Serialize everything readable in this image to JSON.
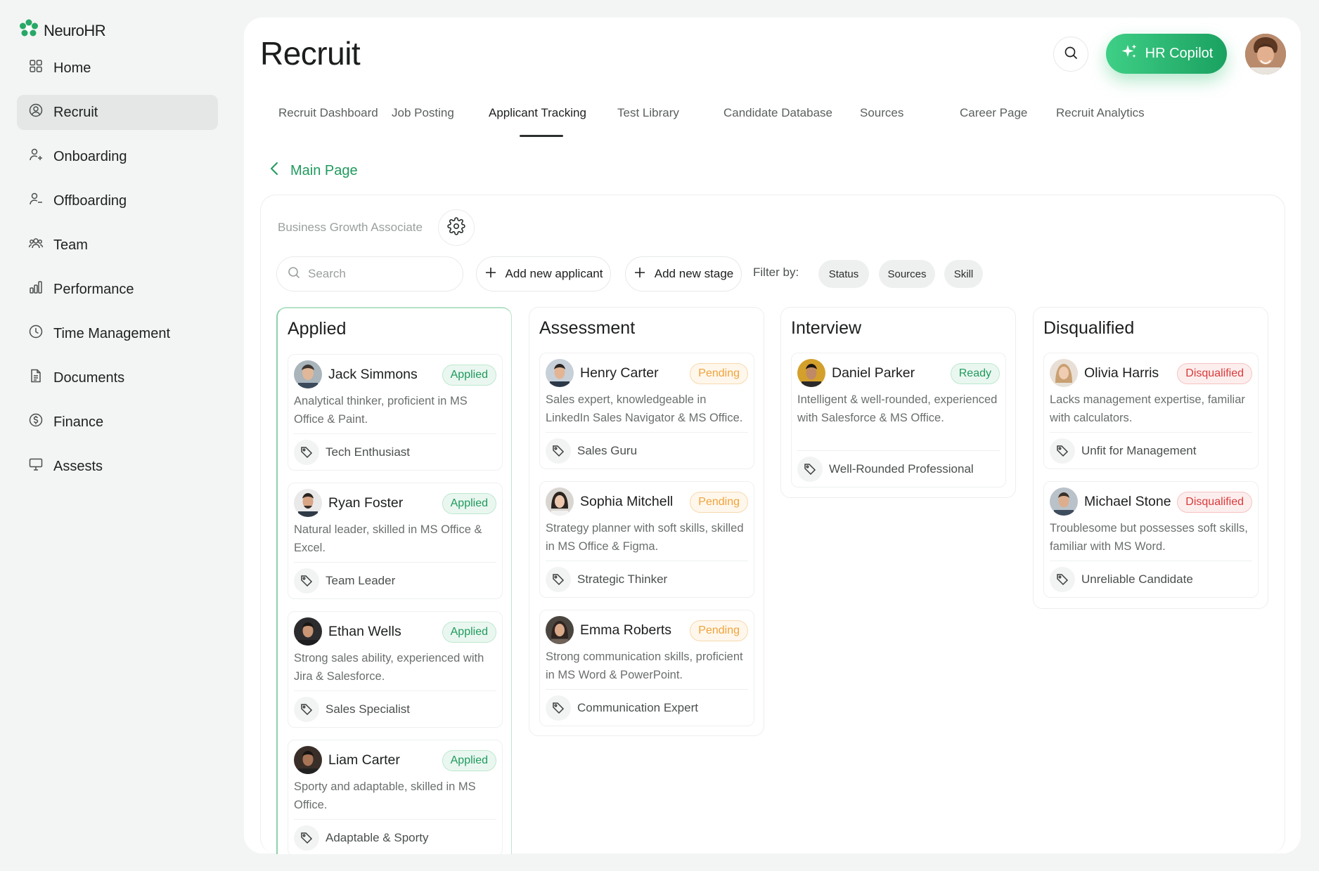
{
  "app": {
    "name": "NeuroHR"
  },
  "sidebar": {
    "items": [
      {
        "label": "Home",
        "icon": "grid-icon",
        "active": false
      },
      {
        "label": "Recruit",
        "icon": "user-circle-icon",
        "active": true
      },
      {
        "label": "Onboarding",
        "icon": "user-plus-icon",
        "active": false
      },
      {
        "label": "Offboarding",
        "icon": "user-minus-icon",
        "active": false
      },
      {
        "label": "Team",
        "icon": "users-icon",
        "active": false
      },
      {
        "label": "Performance",
        "icon": "bar-chart-icon",
        "active": false
      },
      {
        "label": "Time Management",
        "icon": "clock-icon",
        "active": false
      },
      {
        "label": "Documents",
        "icon": "document-icon",
        "active": false
      },
      {
        "label": "Finance",
        "icon": "dollar-icon",
        "active": false
      },
      {
        "label": "Assests",
        "icon": "monitor-icon",
        "active": false
      }
    ]
  },
  "header": {
    "title": "Recruit",
    "copilot_label": "HR Copilot"
  },
  "tabs": [
    {
      "label": "Recruit Dashboard",
      "active": false
    },
    {
      "label": "Job Posting",
      "active": false
    },
    {
      "label": "Applicant Tracking",
      "active": true
    },
    {
      "label": "Test Library",
      "active": false
    },
    {
      "label": "Candidate Database",
      "active": false
    },
    {
      "label": "Sources",
      "active": false
    },
    {
      "label": "Career Page",
      "active": false
    },
    {
      "label": "Recruit Analytics",
      "active": false
    }
  ],
  "back_link": "Main Page",
  "board": {
    "job_title": "Business Growth Associate",
    "search_placeholder": "Search",
    "add_applicant_label": "Add new applicant",
    "add_stage_label": "Add new stage",
    "filter_label": "Filter by:",
    "filters": [
      "Status",
      "Sources",
      "Skill"
    ]
  },
  "columns": [
    {
      "title": "Applied",
      "cards": [
        {
          "name": "Jack Simmons",
          "status": "Applied",
          "desc": "Analytical thinker, proficient in MS Office & Paint.",
          "tag": "Tech Enthusiast"
        },
        {
          "name": "Ryan Foster",
          "status": "Applied",
          "desc": "Natural leader, skilled in MS Office & Excel.",
          "tag": "Team Leader"
        },
        {
          "name": "Ethan Wells",
          "status": "Applied",
          "desc": " Strong sales ability, experienced with Jira & Salesforce.",
          "tag": "Sales Specialist"
        },
        {
          "name": "Liam Carter",
          "status": "Applied",
          "desc": "Sporty and adaptable, skilled in MS Office.",
          "tag": "Adaptable & Sporty"
        }
      ]
    },
    {
      "title": "Assessment",
      "cards": [
        {
          "name": "Henry Carter",
          "status": "Pending",
          "desc": "Sales expert, knowledgeable in LinkedIn Sales Navigator & MS Office.",
          "tag": "Sales Guru"
        },
        {
          "name": "Sophia Mitchell",
          "status": "Pending",
          "desc": "Strategy planner with soft skills, skilled in MS Office & Figma.",
          "tag": "Strategic Thinker"
        },
        {
          "name": "Emma Roberts",
          "status": "Pending",
          "desc": "Strong communication skills, proficient in MS Word & PowerPoint.",
          "tag": "Communication Expert"
        }
      ]
    },
    {
      "title": "Interview",
      "cards": [
        {
          "name": "Daniel Parker",
          "status": "Ready",
          "desc": "Intelligent & well-rounded, experienced with Salesforce & MS Office.",
          "tag": "Well-Rounded Professional"
        }
      ]
    },
    {
      "title": "Disqualified",
      "cards": [
        {
          "name": "Olivia Harris",
          "status": "Disqualified",
          "desc": "Lacks management expertise, familiar with calculators.",
          "tag": "Unfit for Management"
        },
        {
          "name": "Michael Stone",
          "status": "Disqualified",
          "desc": "Troublesome but possesses soft skills, familiar with MS Word.",
          "tag": "Unreliable Candidate"
        }
      ]
    }
  ],
  "colors": {
    "accent_green": "#1f9a5d",
    "pending_orange": "#f0a33b",
    "disqualified_red": "#d93a3a"
  }
}
